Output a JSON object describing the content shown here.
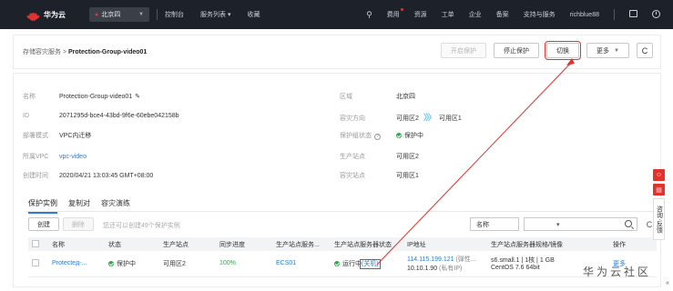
{
  "topbar": {
    "brand": "华为云",
    "region": "北京四",
    "nav": [
      "控制台",
      "服务列表",
      "收藏"
    ],
    "nav_caret": "▾",
    "right": [
      "费用",
      "资源",
      "工单",
      "企业",
      "备案",
      "支持与服务",
      "richblue88"
    ]
  },
  "header": {
    "breadcrumb_root": "存储容灾服务",
    "breadcrumb_sep": " > ",
    "breadcrumb_current": "Protection-Group-video01",
    "buttons": {
      "enable_protect": "开启保护",
      "stop_protect": "停止保护",
      "switch": "切换",
      "more": "更多",
      "refresh": "C"
    }
  },
  "details": {
    "name_label": "名称",
    "name_value": "Protection-Group-video01",
    "id_label": "ID",
    "id_value": "2071295d-bce4-43bd-9f6e-60ebe042158b",
    "mode_label": "部署模式",
    "mode_value": "VPC内迁移",
    "vpc_label": "所属VPC",
    "vpc_value": "vpc-video",
    "created_label": "创建时间",
    "created_value": "2020/04/21 13:03:45 GMT+08:00",
    "region_label": "区域",
    "region_value": "北京四",
    "dr_dir_label": "容灾方向",
    "dr_from": "可用区2",
    "dr_arrows": "〉〉〉",
    "dr_to": "可用区1",
    "pg_status_label": "保护组状态",
    "pg_status_value": "保护中",
    "prod_site_label": "生产站点",
    "prod_site_value": "可用区2",
    "dr_site_label": "容灾站点",
    "dr_site_value": "可用区1"
  },
  "tabs": [
    "保护实例",
    "复制对",
    "容灾演练"
  ],
  "toolbar": {
    "create": "创建",
    "delete": "删除",
    "hint": "您还可以创建49个保护实例",
    "select_value": "名称",
    "select_caret": "▾",
    "refresh": "C"
  },
  "table": {
    "headers": [
      "名称",
      "状态",
      "生产站点",
      "同步进度",
      "生产站点服务...",
      "生产站点服务器状态",
      "IP地址",
      "生产站点服务器规格/镜像",
      "操作"
    ],
    "rows": [
      {
        "name": "Protecteд-...",
        "status": "保护中",
        "site": "可用区2",
        "progress": "100%",
        "server": "ECS01",
        "server_status": "运行中",
        "server_status_extra": "(关机)",
        "ip1": "114.115.199.121",
        "ip1_note": "(弹性...",
        "ip2": "10.10.1.90",
        "ip2_note": "(私有IP)",
        "spec1": "s6.small.1 | 1核 | 1 GB",
        "spec2": "CentOS 7.6 64bit",
        "op": "更多"
      }
    ]
  },
  "watermark": "华为云社区",
  "side": {
    "consult": "咨询·反馈"
  },
  "colors": {
    "topbar": "#1d2129",
    "accent_red": "#e3312d",
    "link_blue": "#2b7cd3",
    "ok_green": "#2ea84d"
  }
}
